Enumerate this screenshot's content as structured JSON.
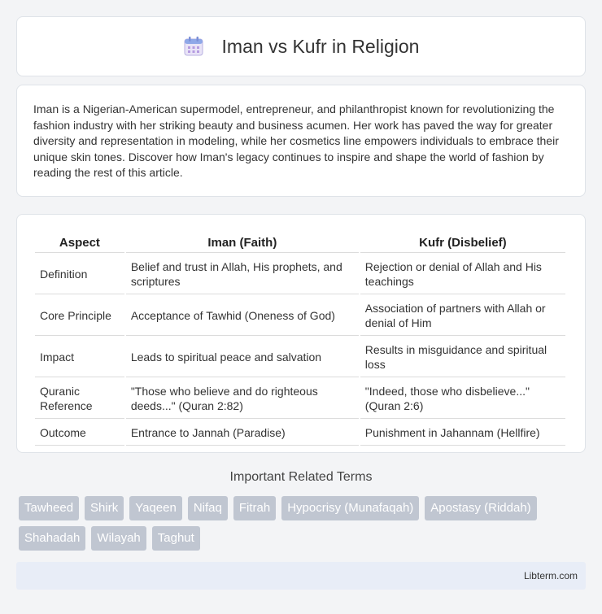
{
  "header": {
    "title": "Iman vs Kufr in Religion",
    "icon": "calendar-icon"
  },
  "intro": {
    "text": "Iman is a Nigerian-American supermodel, entrepreneur, and philanthropist known for revolutionizing the fashion industry with her striking beauty and business acumen. Her work has paved the way for greater diversity and representation in modeling, while her cosmetics line empowers individuals to embrace their unique skin tones. Discover how Iman's legacy continues to inspire and shape the world of fashion by reading the rest of this article."
  },
  "table": {
    "headers": [
      "Aspect",
      "Iman (Faith)",
      "Kufr (Disbelief)"
    ],
    "rows": [
      [
        "Definition",
        "Belief and trust in Allah, His prophets, and scriptures",
        "Rejection or denial of Allah and His teachings"
      ],
      [
        "Core Principle",
        "Acceptance of Tawhid (Oneness of God)",
        "Association of partners with Allah or denial of Him"
      ],
      [
        "Impact",
        "Leads to spiritual peace and salvation",
        "Results in misguidance and spiritual loss"
      ],
      [
        "Quranic Reference",
        "\"Those who believe and do righteous deeds...\" (Quran 2:82)",
        "\"Indeed, those who disbelieve...\" (Quran 2:6)"
      ],
      [
        "Outcome",
        "Entrance to Jannah (Paradise)",
        "Punishment in Jahannam (Hellfire)"
      ]
    ]
  },
  "related": {
    "title": "Important Related Terms",
    "tags": [
      "Tawheed",
      "Shirk",
      "Yaqeen",
      "Nifaq",
      "Fitrah",
      "Hypocrisy (Munafaqah)",
      "Apostasy (Riddah)",
      "Shahadah",
      "Wilayah",
      "Taghut"
    ]
  },
  "footer": {
    "text": "Libterm.com"
  },
  "colors": {
    "tag_bg": "#c0c6d1",
    "footer_bg": "#e8edf7",
    "page_bg": "#f3f4f6"
  }
}
